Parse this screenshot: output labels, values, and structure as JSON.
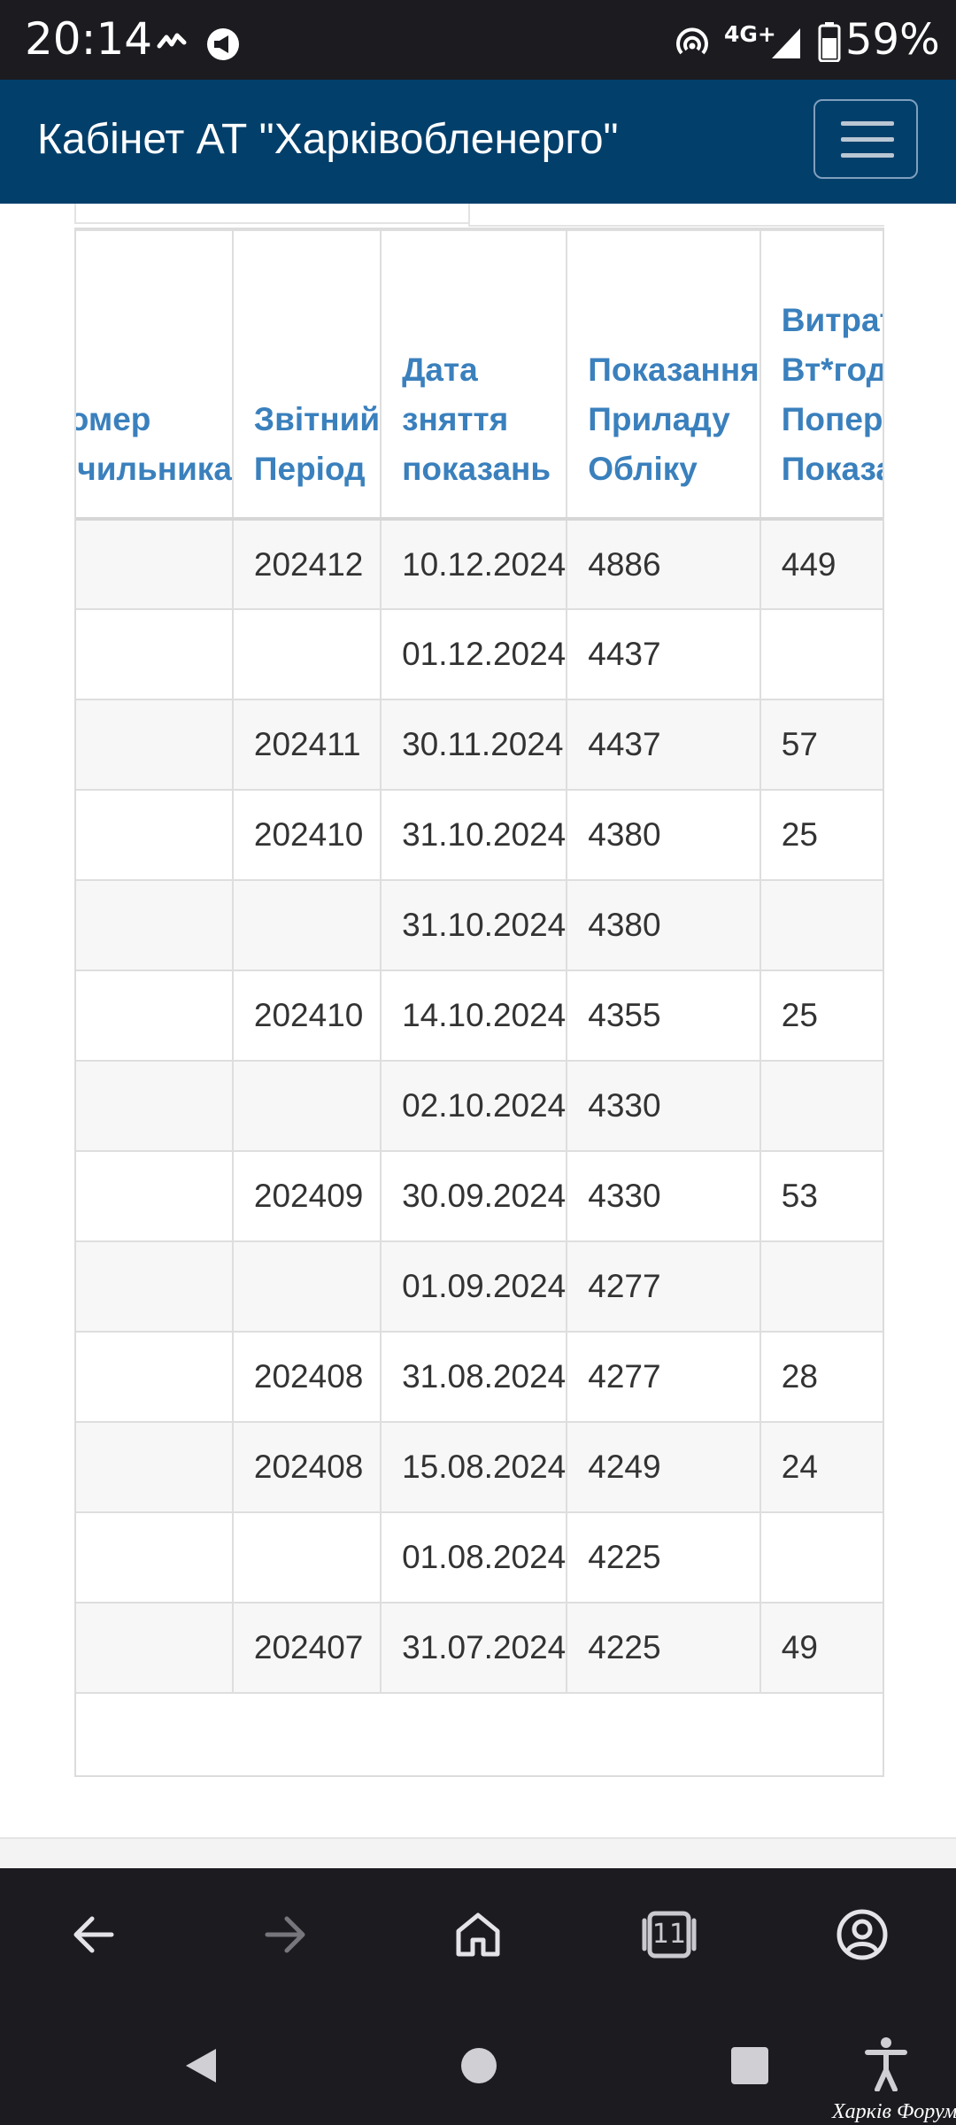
{
  "status_bar": {
    "time": "20:14",
    "network": "4G+",
    "battery": "59%",
    "icons": [
      "pulse-icon",
      "megaphone-icon",
      "hotspot-icon",
      "signal-icon",
      "battery-icon"
    ]
  },
  "navbar": {
    "brand": "Кабінет АТ \"Харківобленерго\"",
    "menu_icon": "hamburger-icon",
    "bg_color": "#033f6b"
  },
  "table": {
    "headers": [
      "Номер Лічильника",
      "Звітний Період",
      "Дата зняття показань",
      "Показання Приладу Обліку",
      "Витрата К Вт*год Від Попередніх Показань"
    ],
    "rows": [
      {
        "period": "202412",
        "date": "10.12.2024",
        "reading": "4886",
        "usage": "449"
      },
      {
        "period": "",
        "date": "01.12.2024",
        "reading": "4437",
        "usage": ""
      },
      {
        "period": "202411",
        "date": "30.11.2024",
        "reading": "4437",
        "usage": "57"
      },
      {
        "period": "202410",
        "date": "31.10.2024",
        "reading": "4380",
        "usage": "25"
      },
      {
        "period": "",
        "date": "31.10.2024",
        "reading": "4380",
        "usage": ""
      },
      {
        "period": "202410",
        "date": "14.10.2024",
        "reading": "4355",
        "usage": "25"
      },
      {
        "period": "",
        "date": "02.10.2024",
        "reading": "4330",
        "usage": ""
      },
      {
        "period": "202409",
        "date": "30.09.2024",
        "reading": "4330",
        "usage": "53"
      },
      {
        "period": "",
        "date": "01.09.2024",
        "reading": "4277",
        "usage": ""
      },
      {
        "period": "202408",
        "date": "31.08.2024",
        "reading": "4277",
        "usage": "28"
      },
      {
        "period": "202408",
        "date": "15.08.2024",
        "reading": "4249",
        "usage": "24"
      },
      {
        "period": "",
        "date": "01.08.2024",
        "reading": "4225",
        "usage": ""
      },
      {
        "period": "202407",
        "date": "31.07.2024",
        "reading": "4225",
        "usage": "49"
      }
    ]
  },
  "browser_toolbar": {
    "tab_count": "11",
    "icons": [
      "back-arrow-icon",
      "forward-arrow-icon",
      "home-icon",
      "tabs-icon",
      "account-icon"
    ]
  },
  "system_nav": {
    "icons": [
      "back-triangle-icon",
      "home-circle-icon",
      "recents-square-icon",
      "accessibility-icon"
    ],
    "watermark": "Харків Форум"
  },
  "colors": {
    "header_text": "#3a80bd",
    "cell_text": "#333333",
    "stripe": "#f7f7f7"
  }
}
